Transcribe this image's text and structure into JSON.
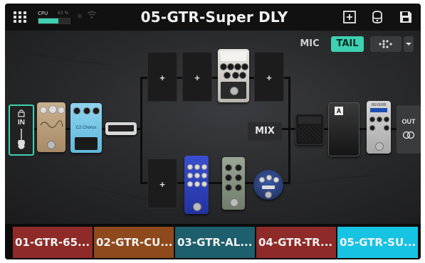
{
  "topbar": {
    "menu_icon": "grid-menu-icon",
    "cpu_label": "CPU",
    "cpu_percent_text": "63 %",
    "cpu_level": 0.63,
    "cpu_color": "#3ed1b1",
    "bluetooth_icon": "bluetooth-icon",
    "wifi_icon": "wifi-icon",
    "preset_title": "05-GTR-Super DLY",
    "add_icon": "add-box-icon",
    "tuner_icon": "tuner-icon",
    "save_icon": "save-icon"
  },
  "signal_controls": {
    "mic_label": "MIC",
    "tail_label": "TAIL",
    "tail_active_color": "#3ed1b1",
    "layout_icon": "layout-dots-icon",
    "dropdown_icon": "chevron-down-icon"
  },
  "chain": {
    "input_label": "IN",
    "input_lock_icon": "lock-icon",
    "input_guitar_icon": "guitar-icon",
    "output_label": "OUT",
    "output_icon": "stereo-rings-icon",
    "mix_label": "MIX",
    "empty_slot_symbol": "+",
    "reverb_label": "REVERB",
    "volume_pedal_letter": "A",
    "chorus_label": "C2 Chorus",
    "plus_labels": [
      "+",
      "+",
      "+",
      "+"
    ]
  },
  "setlist": {
    "presets": [
      {
        "label": "01-GTR-65...",
        "color": "#8e2a27"
      },
      {
        "label": "02-GTR-CU...",
        "color": "#8e4a1c"
      },
      {
        "label": "03-GTR-AL...",
        "color": "#1d5f6c"
      },
      {
        "label": "04-GTR-TR...",
        "color": "#8e2a27"
      },
      {
        "label": "05-GTR-SU...",
        "color": "#17c3e2"
      }
    ]
  }
}
